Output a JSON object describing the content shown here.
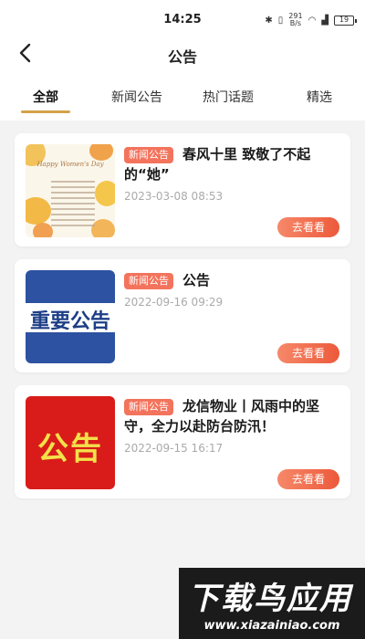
{
  "status_bar": {
    "time": "14:25",
    "net_speed_value": "291",
    "net_speed_unit": "B/s",
    "battery": "19"
  },
  "header": {
    "title": "公告",
    "back_icon": "chevron-left-icon"
  },
  "tabs": [
    {
      "label": "全部",
      "active": true
    },
    {
      "label": "新闻公告",
      "active": false
    },
    {
      "label": "热门话题",
      "active": false
    },
    {
      "label": "精选",
      "active": false
    }
  ],
  "articles": [
    {
      "badge": "新闻公告",
      "title": "春风十里 致敬了不起的“她”",
      "date": "2023-03-08 08:53",
      "button": "去看看",
      "thumb_text": "Happy Women's Day"
    },
    {
      "badge": "新闻公告",
      "title": "公告",
      "date": "2022-09-16 09:29",
      "button": "去看看",
      "thumb_text": "重要公告"
    },
    {
      "badge": "新闻公告",
      "title": "龙信物业丨风雨中的坚守，全力以赴防台防汛！",
      "date": "2022-09-15 16:17",
      "button": "去看看",
      "thumb_text": "公告"
    }
  ],
  "watermark": {
    "title": "下载鸟应用",
    "url": "www.xiazainiao.com"
  },
  "colors": {
    "accent_underline": "#d4a24a",
    "badge": "#f3735c",
    "button_gradient_start": "#f6886a",
    "button_gradient_end": "#ec5a3a"
  }
}
